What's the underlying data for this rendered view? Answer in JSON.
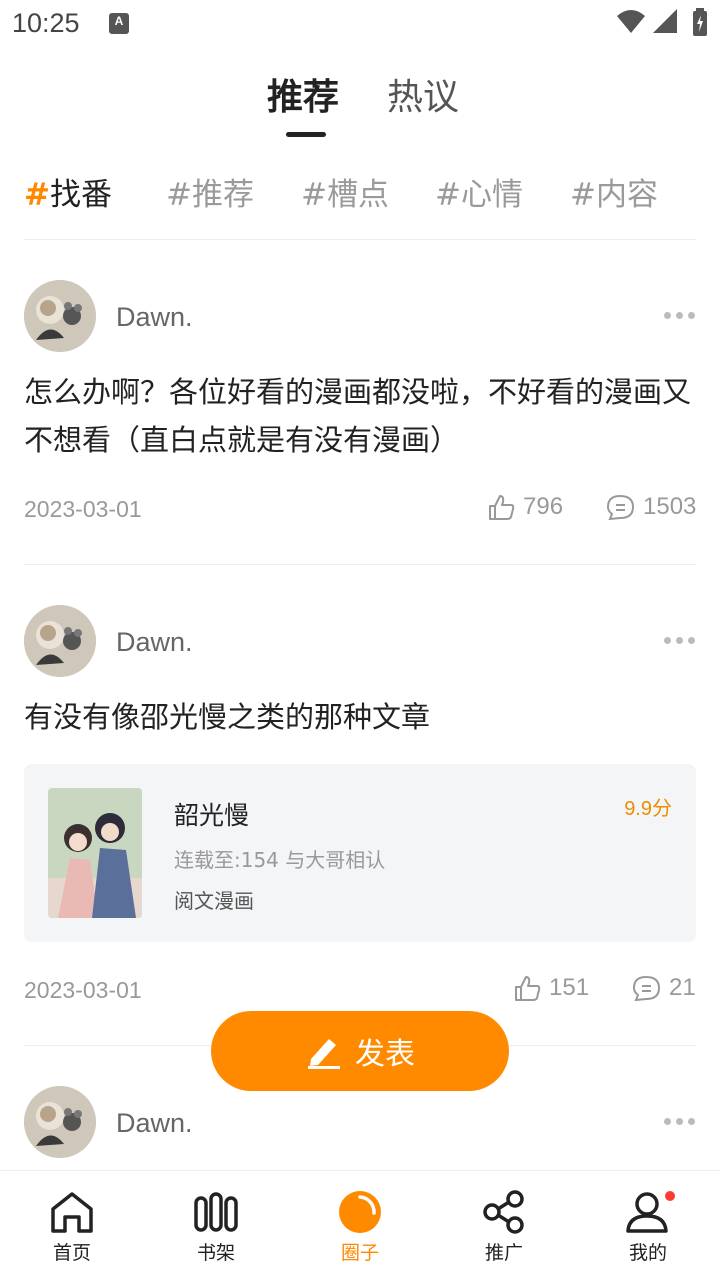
{
  "status_bar": {
    "time": "10:25",
    "a11y_label": "A"
  },
  "top_tabs": [
    {
      "label": "推荐",
      "active": true
    },
    {
      "label": "热议",
      "active": false
    }
  ],
  "topic_chips": [
    {
      "hash": "#",
      "label": "找番",
      "active": true
    },
    {
      "hash": "#",
      "label": "推荐",
      "active": false
    },
    {
      "hash": "#",
      "label": "槽点",
      "active": false
    },
    {
      "hash": "#",
      "label": "心情",
      "active": false
    },
    {
      "hash": "#",
      "label": "内容",
      "active": false
    }
  ],
  "posts": [
    {
      "username": "Dawn.",
      "text": "怎么办啊？各位好看的漫画都没啦，不好看的漫画又不想看（直白点就是有没有漫画）",
      "date": "2023-03-01",
      "likes": "796",
      "comments": "1503"
    },
    {
      "username": "Dawn.",
      "text": "有没有像邵光慢之类的那种文章",
      "book": {
        "title": "韶光慢",
        "score": "9.9分",
        "progress": "连载至:154 与大哥相认",
        "source": "阅文漫画"
      },
      "date": "2023-03-01",
      "likes": "151",
      "comments": "21"
    },
    {
      "username": "Dawn."
    }
  ],
  "publish_button": {
    "label": "发表",
    "icon": "pen-icon"
  },
  "bottom_nav": [
    {
      "label": "首页",
      "icon": "home-icon",
      "active": false
    },
    {
      "label": "书架",
      "icon": "bookshelf-icon",
      "active": false
    },
    {
      "label": "圈子",
      "icon": "circle-icon",
      "active": true
    },
    {
      "label": "推广",
      "icon": "share-icon",
      "active": false
    },
    {
      "label": "我的",
      "icon": "profile-icon",
      "active": false,
      "badge": true
    }
  ],
  "colors": {
    "accent": "#ff8a00",
    "badge": "#ff3b30"
  }
}
